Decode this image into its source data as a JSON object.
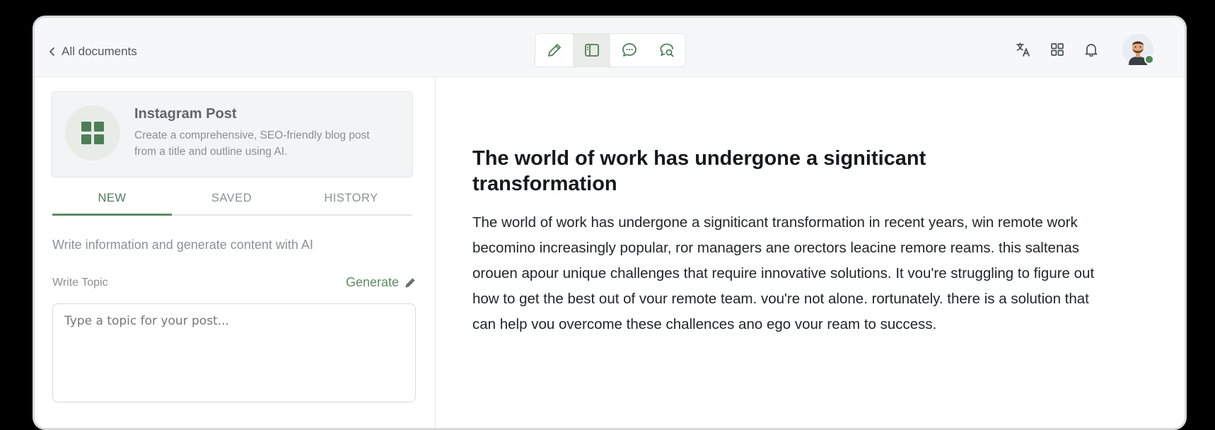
{
  "header": {
    "back_label": "All documents",
    "toolbar": [
      {
        "icon": "pencil-icon",
        "active": false
      },
      {
        "icon": "sidebar-panel-icon",
        "active": true
      },
      {
        "icon": "chat-bubble-icon",
        "active": false
      },
      {
        "icon": "search-chat-icon",
        "active": false
      }
    ],
    "right_icons": [
      "translate-icon",
      "apps-grid-icon",
      "bell-icon"
    ],
    "avatar": {
      "status": "online",
      "status_color": "#4e8a56"
    }
  },
  "sidebar": {
    "card": {
      "title": "Instagram Post",
      "description": "Create a comprehensive, SEO-friendly blog post from a title and outline using AI.",
      "icon": "grid-icon",
      "icon_color": "#4d7e57"
    },
    "tabs": [
      {
        "label": "NEW",
        "active": true
      },
      {
        "label": "SAVED",
        "active": false
      },
      {
        "label": "HISTORY",
        "active": false
      }
    ],
    "intro": "Write information and generate content with AI",
    "topic_label": "Write Topic",
    "generate_label": "Generate",
    "topic_placeholder": "Type a topic for your post..."
  },
  "document": {
    "title": "The world of work has undergone a signiticant transformation",
    "body": "The world of work has undergone a signiticant transformation in recent years, win remote work becomino increasingly popular, ror managers ane orectors leacine remore reams. this saltenas orouen apour unique challenges that require innovative solutions. It vou're struggling to figure out how to get the best out of vour remote team. vou're not alone. rortunately. there is a solution that can help vou overcome these challences ano ego vour ream to success."
  },
  "colors": {
    "accent": "#5d8b63",
    "text_dark": "#16191b",
    "muted": "#8b9196"
  }
}
